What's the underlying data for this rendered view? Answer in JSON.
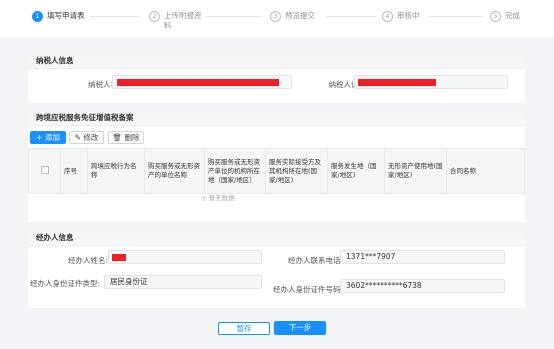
{
  "steps": [
    {
      "num": "1",
      "label": "填写申请表",
      "label2": ""
    },
    {
      "num": "2",
      "label": "上传附报资",
      "label2": "料"
    },
    {
      "num": "3",
      "label": "预览提交",
      "label2": ""
    },
    {
      "num": "4",
      "label": "审核中",
      "label2": ""
    },
    {
      "num": "5",
      "label": "完成",
      "label2": ""
    }
  ],
  "taxpayer": {
    "section_title": "纳税人信息",
    "name_label": "纳税人名称:",
    "id_label": "纳税人识别号:",
    "redaction_color": "#ee1f25"
  },
  "filing": {
    "section_title": "跨境应税服务免征增值税备案",
    "add_label": "+ 添加",
    "edit_label": "修改",
    "delete_label": "删除",
    "columns": [
      "序号",
      "跨境应税行为名称",
      "购买服务或无形资产的单位名称",
      "购买服务或无形资产单位的机构所在地（国家/地区）",
      "服务实际接受方及其机构所在地(国家/地区)",
      "服务发生地（国家/地区)",
      "无形资产使用地(国家/地区)",
      "合同名称"
    ],
    "empty_text": "暂无数据"
  },
  "agent": {
    "section_title": "经办人信息",
    "name_label": "经办人姓名:",
    "phone_label": "经办人联系电话:",
    "phone_value": "1371***7907",
    "idtype_label": "经办人身份证件类型:",
    "idtype_value": "居民身份证",
    "idno_label": "经办人身份证件号码:",
    "idno_value": "3602**********6738"
  },
  "actions": {
    "save_label": "暂存",
    "next_label": "下一步"
  },
  "colors": {
    "accent": "#1890ff",
    "redaction": "#ee1f25"
  }
}
